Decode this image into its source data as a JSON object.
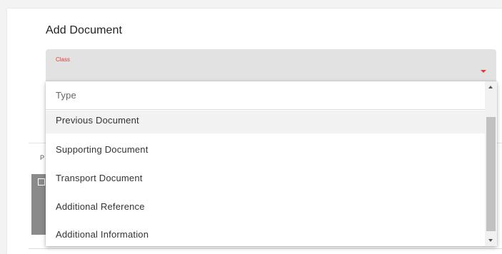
{
  "form": {
    "title": "Add Document",
    "class_label": "Class"
  },
  "background": {
    "partial_label": "P"
  },
  "dropdown": {
    "options": [
      "Type",
      "Previous Document",
      "Supporting Document",
      "Transport Document",
      "Additional Reference",
      "Additional Information"
    ]
  },
  "colors": {
    "accent": "#e53935",
    "field_bg": "#e2e2e2",
    "highlight_bg": "#f2f2f2"
  }
}
